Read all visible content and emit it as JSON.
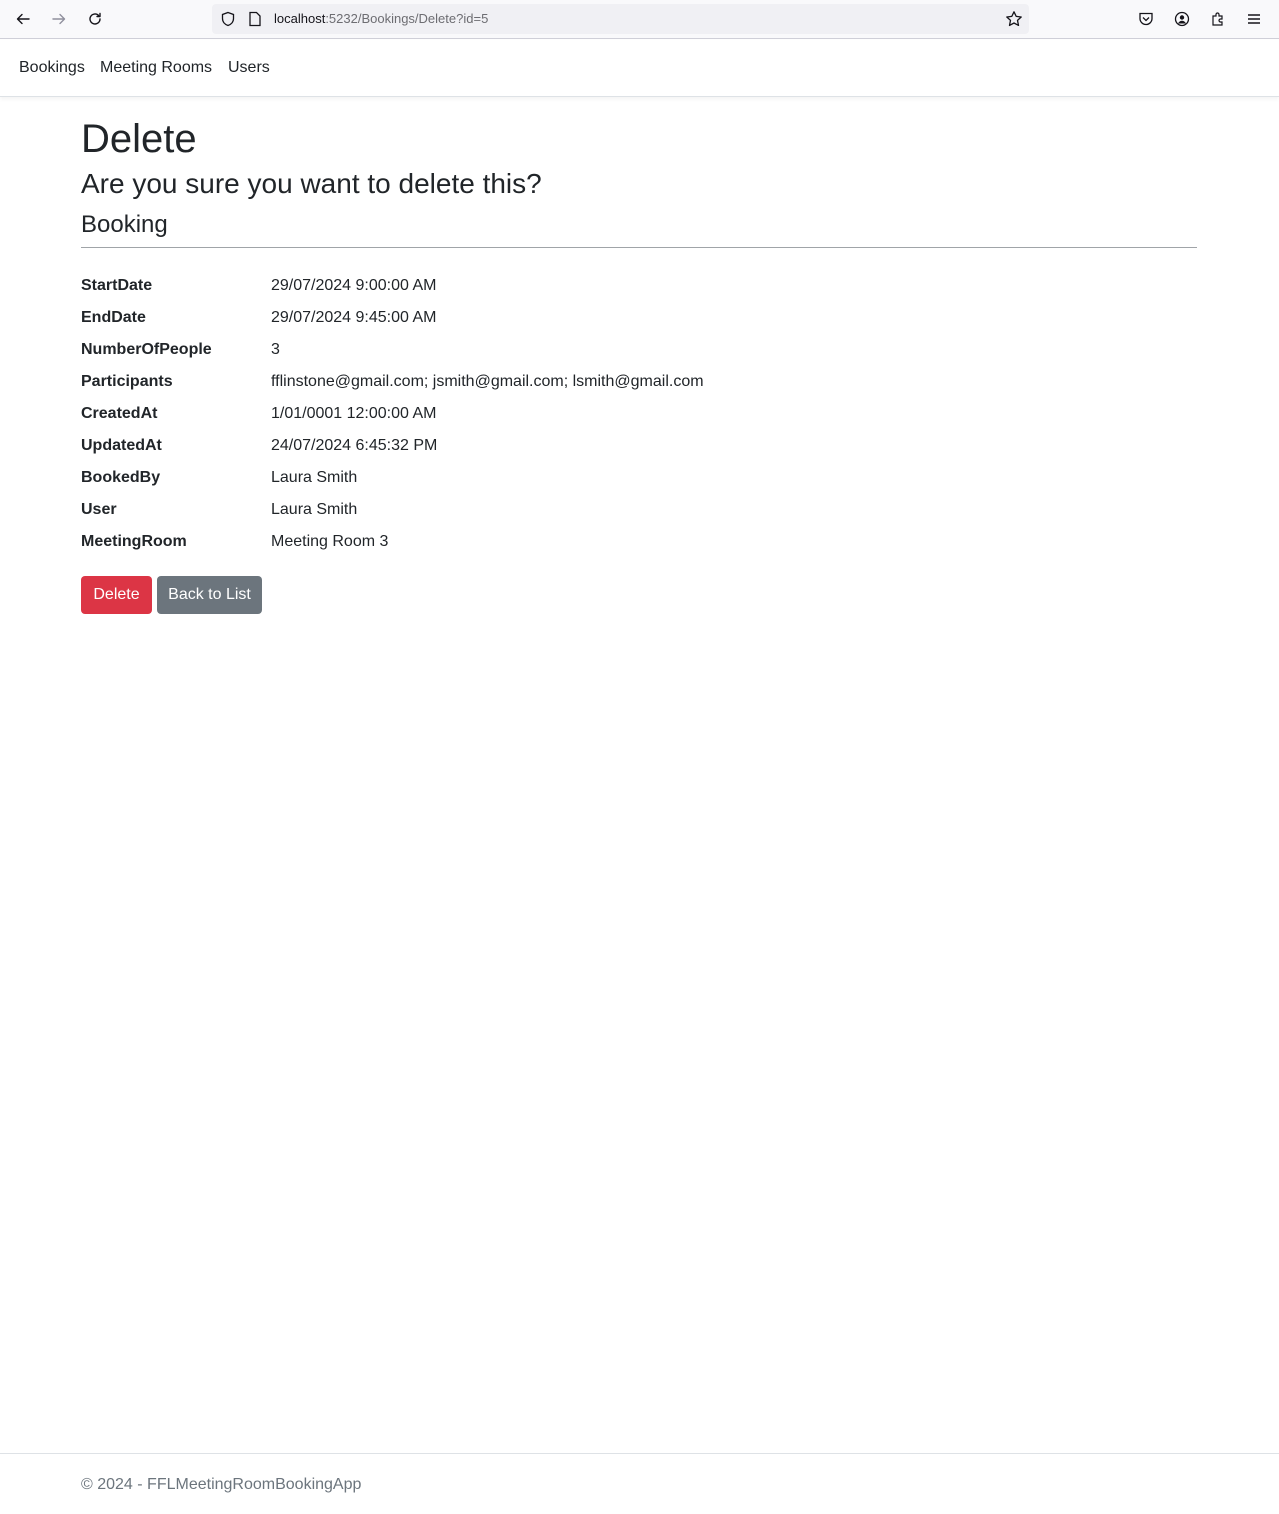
{
  "browser": {
    "url_host": "localhost",
    "url_path": ":5232/Bookings/Delete?id=5",
    "icons": [
      "back-arrow-icon",
      "forward-arrow-icon",
      "reload-icon",
      "shield-icon",
      "page-icon",
      "star-icon",
      "pocket-icon",
      "account-icon",
      "extensions-icon",
      "menu-icon"
    ]
  },
  "nav": {
    "items": [
      "Bookings",
      "Meeting Rooms",
      "Users"
    ]
  },
  "page": {
    "title": "Delete",
    "confirm": "Are you sure you want to delete this?",
    "entity": "Booking"
  },
  "details": [
    {
      "label": "StartDate",
      "value": "29/07/2024 9:00:00 AM"
    },
    {
      "label": "EndDate",
      "value": "29/07/2024 9:45:00 AM"
    },
    {
      "label": "NumberOfPeople",
      "value": "3"
    },
    {
      "label": "Participants",
      "value": "fflinstone@gmail.com; jsmith@gmail.com; lsmith@gmail.com"
    },
    {
      "label": "CreatedAt",
      "value": "1/01/0001 12:00:00 AM"
    },
    {
      "label": "UpdatedAt",
      "value": "24/07/2024 6:45:32 PM"
    },
    {
      "label": "BookedBy",
      "value": "Laura Smith"
    },
    {
      "label": "User",
      "value": "Laura Smith"
    },
    {
      "label": "MeetingRoom",
      "value": "Meeting Room 3"
    }
  ],
  "actions": {
    "delete_label": "Delete",
    "back_label": "Back to List"
  },
  "footer": {
    "text": "© 2024 - FFLMeetingRoomBookingApp"
  },
  "colors": {
    "danger": "#dc3545",
    "secondary": "#6c757d"
  }
}
